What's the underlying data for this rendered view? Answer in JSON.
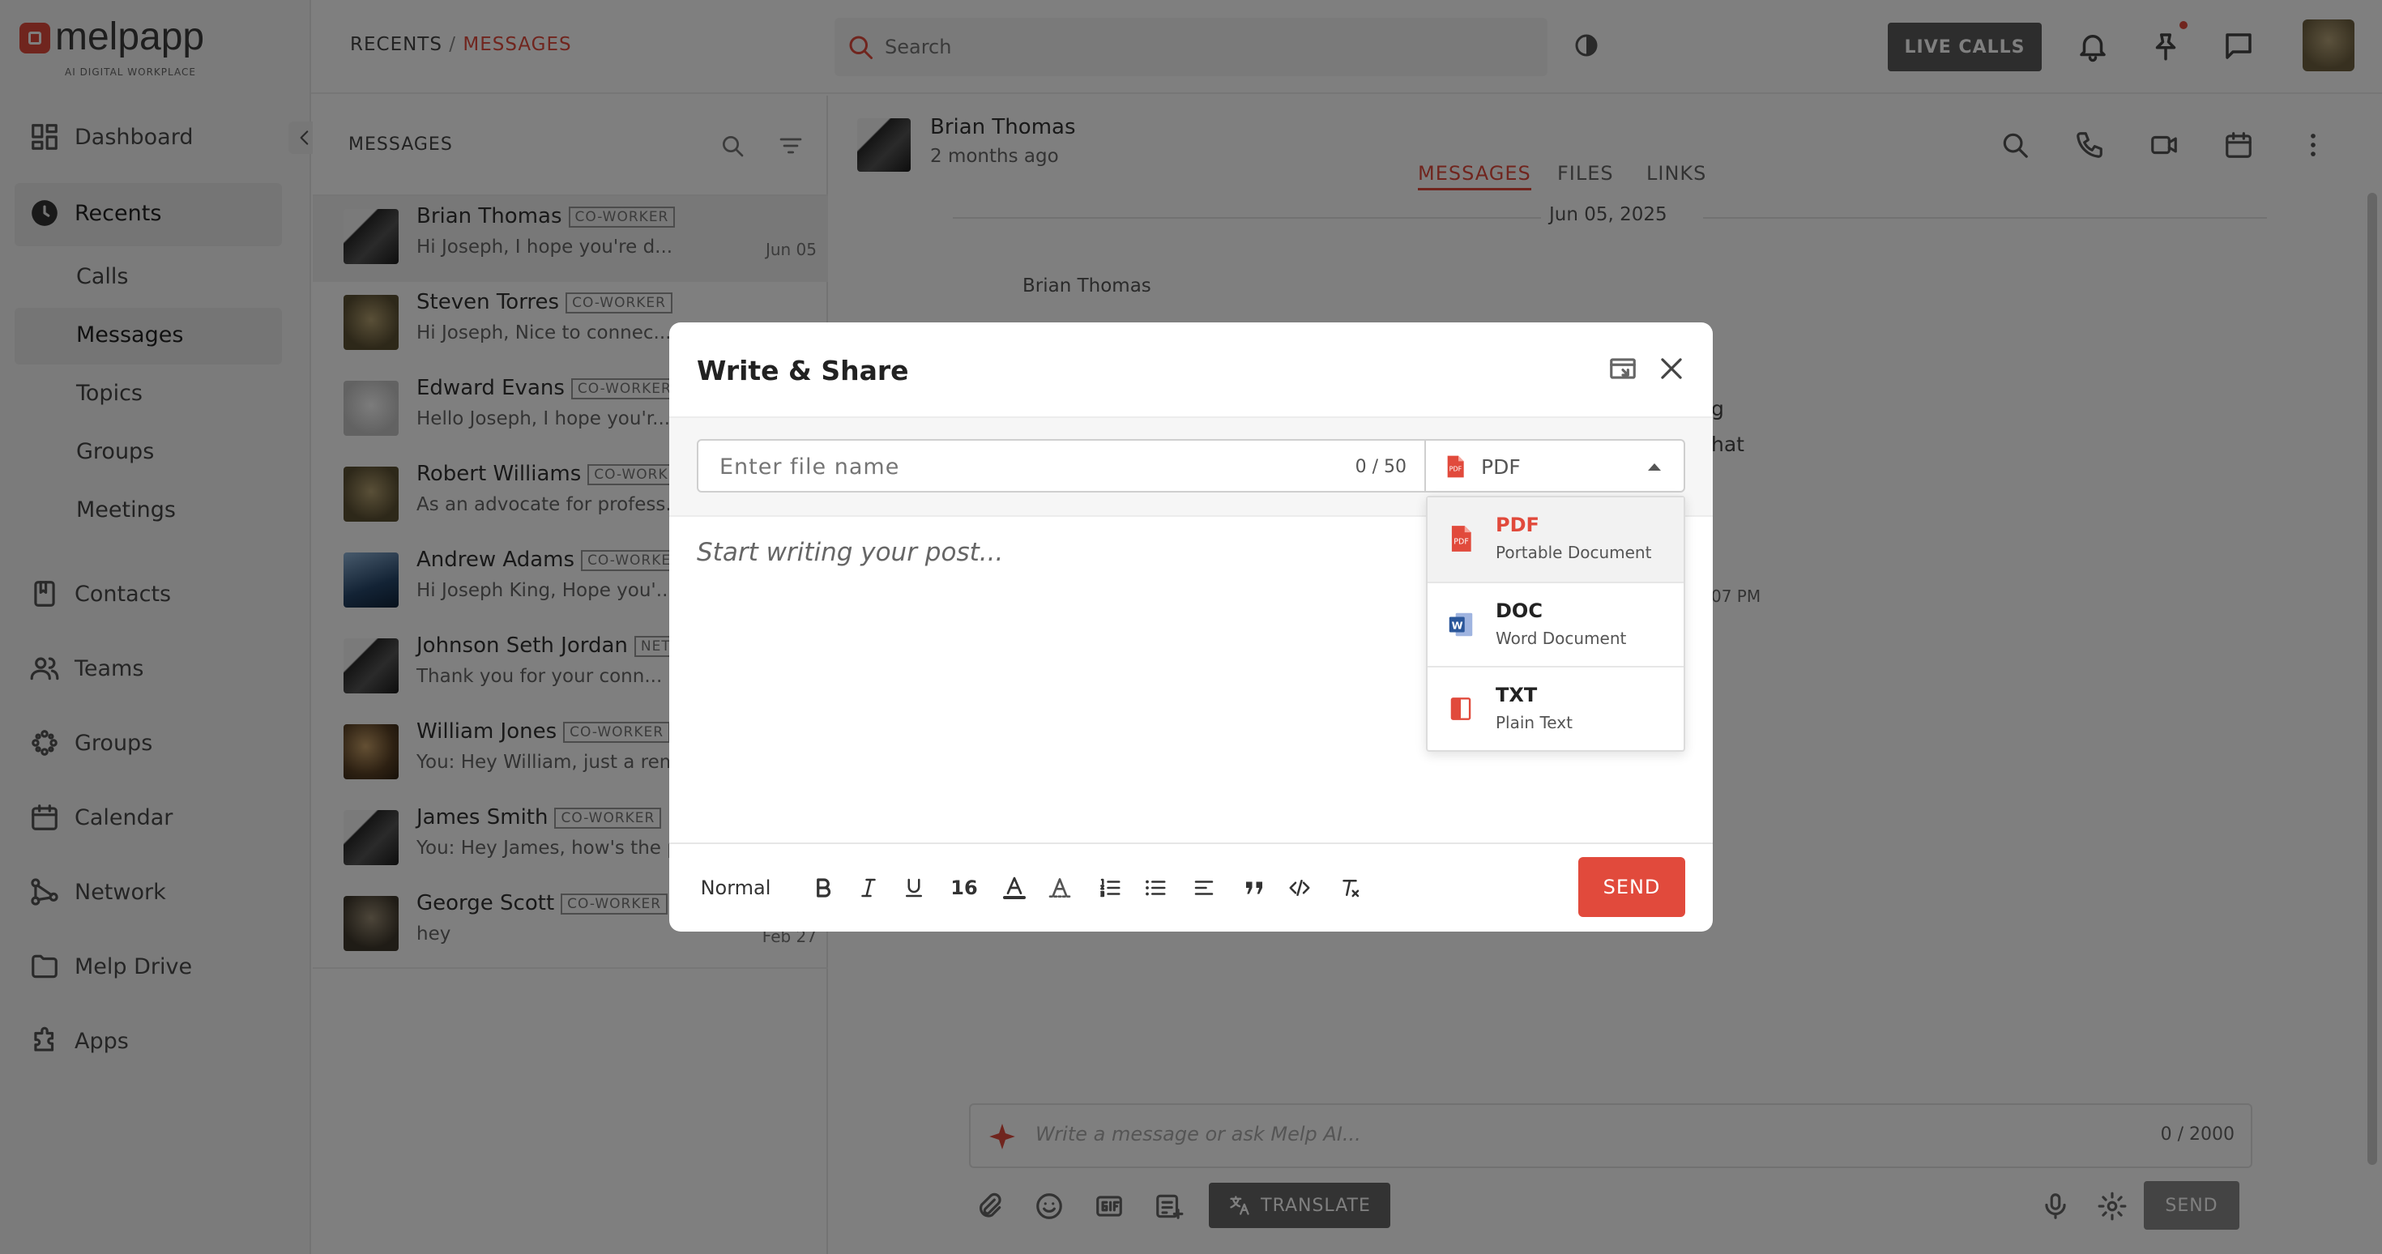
{
  "app": {
    "logo_text": "melpapp",
    "tagline": "AI DIGITAL WORKPLACE"
  },
  "colors": {
    "accent": "#e14a3c",
    "modal_send": "#e14a3c"
  },
  "breadcrumb": {
    "root": "RECENTS",
    "sep": "/",
    "current": "MESSAGES"
  },
  "search": {
    "placeholder": "Search"
  },
  "header": {
    "live_calls": "LIVE CALLS"
  },
  "sidebar": {
    "items": [
      {
        "label": "Dashboard",
        "icon": "dashboard-icon"
      },
      {
        "label": "Recents",
        "icon": "clock-icon"
      },
      {
        "label": "Contacts",
        "icon": "contacts-icon"
      },
      {
        "label": "Teams",
        "icon": "teams-icon"
      },
      {
        "label": "Groups",
        "icon": "groups-icon"
      },
      {
        "label": "Calendar",
        "icon": "calendar-icon"
      },
      {
        "label": "Network",
        "icon": "network-icon"
      },
      {
        "label": "Melp Drive",
        "icon": "folder-icon"
      },
      {
        "label": "Apps",
        "icon": "puzzle-icon"
      }
    ],
    "subitems": [
      "Calls",
      "Messages",
      "Topics",
      "Groups",
      "Meetings"
    ]
  },
  "messages": {
    "title": "MESSAGES",
    "rows": [
      {
        "name": "Brian Thomas",
        "badge": "CO-WORKER",
        "preview": "Hi Joseph, I hope you're d...",
        "date": "Jun 05"
      },
      {
        "name": "Steven Torres",
        "badge": "CO-WORKER",
        "preview": "Hi Joseph, Nice to connec...",
        "date": ""
      },
      {
        "name": "Edward Evans",
        "badge": "CO-WORKER",
        "preview": "Hello Joseph, I hope you'r...",
        "date": ""
      },
      {
        "name": "Robert Williams",
        "badge": "CO-WORKER",
        "preview": "As an advocate for profess...",
        "date": ""
      },
      {
        "name": "Andrew Adams",
        "badge": "CO-WORKER",
        "preview": "Hi Joseph King, Hope you'...",
        "date": ""
      },
      {
        "name": "Johnson Seth Jordan",
        "badge": "NETW",
        "preview": "Thank you for your conn...",
        "date": ""
      },
      {
        "name": "William Jones",
        "badge": "CO-WORKER",
        "preview": "You:  Hey William, just a remin",
        "date": ""
      },
      {
        "name": "James Smith",
        "badge": "CO-WORKER",
        "preview": "You:  Hey James, how's the pro",
        "date": ""
      },
      {
        "name": "George Scott",
        "badge": "CO-WORKER",
        "preview": "hey",
        "date": "Feb 27"
      }
    ]
  },
  "chat": {
    "contact": "Brian Thomas",
    "last_seen": "2 months ago",
    "tabs": [
      "MESSAGES",
      "FILES",
      "LINKS"
    ],
    "date_divider": "Jun 05, 2025",
    "sender": "Brian Thomas",
    "fragment1": "g",
    "fragment2": "hat",
    "fragment3": "07 PM",
    "composer_placeholder": "Write a message or ask Melp AI...",
    "composer_counter": "0 / 2000",
    "translate": "TRANSLATE",
    "send": "SEND"
  },
  "modal": {
    "title": "Write & Share",
    "file_placeholder": "Enter file name",
    "file_counter": "0 / 50",
    "selected_format": "PDF",
    "editor_placeholder": "Start writing your post...",
    "toolbar": {
      "style": "Normal",
      "font_size": "16"
    },
    "send": "SEND",
    "options": [
      {
        "title": "PDF",
        "subtitle": "Portable Document"
      },
      {
        "title": "DOC",
        "subtitle": "Word Document"
      },
      {
        "title": "TXT",
        "subtitle": "Plain Text"
      }
    ]
  }
}
